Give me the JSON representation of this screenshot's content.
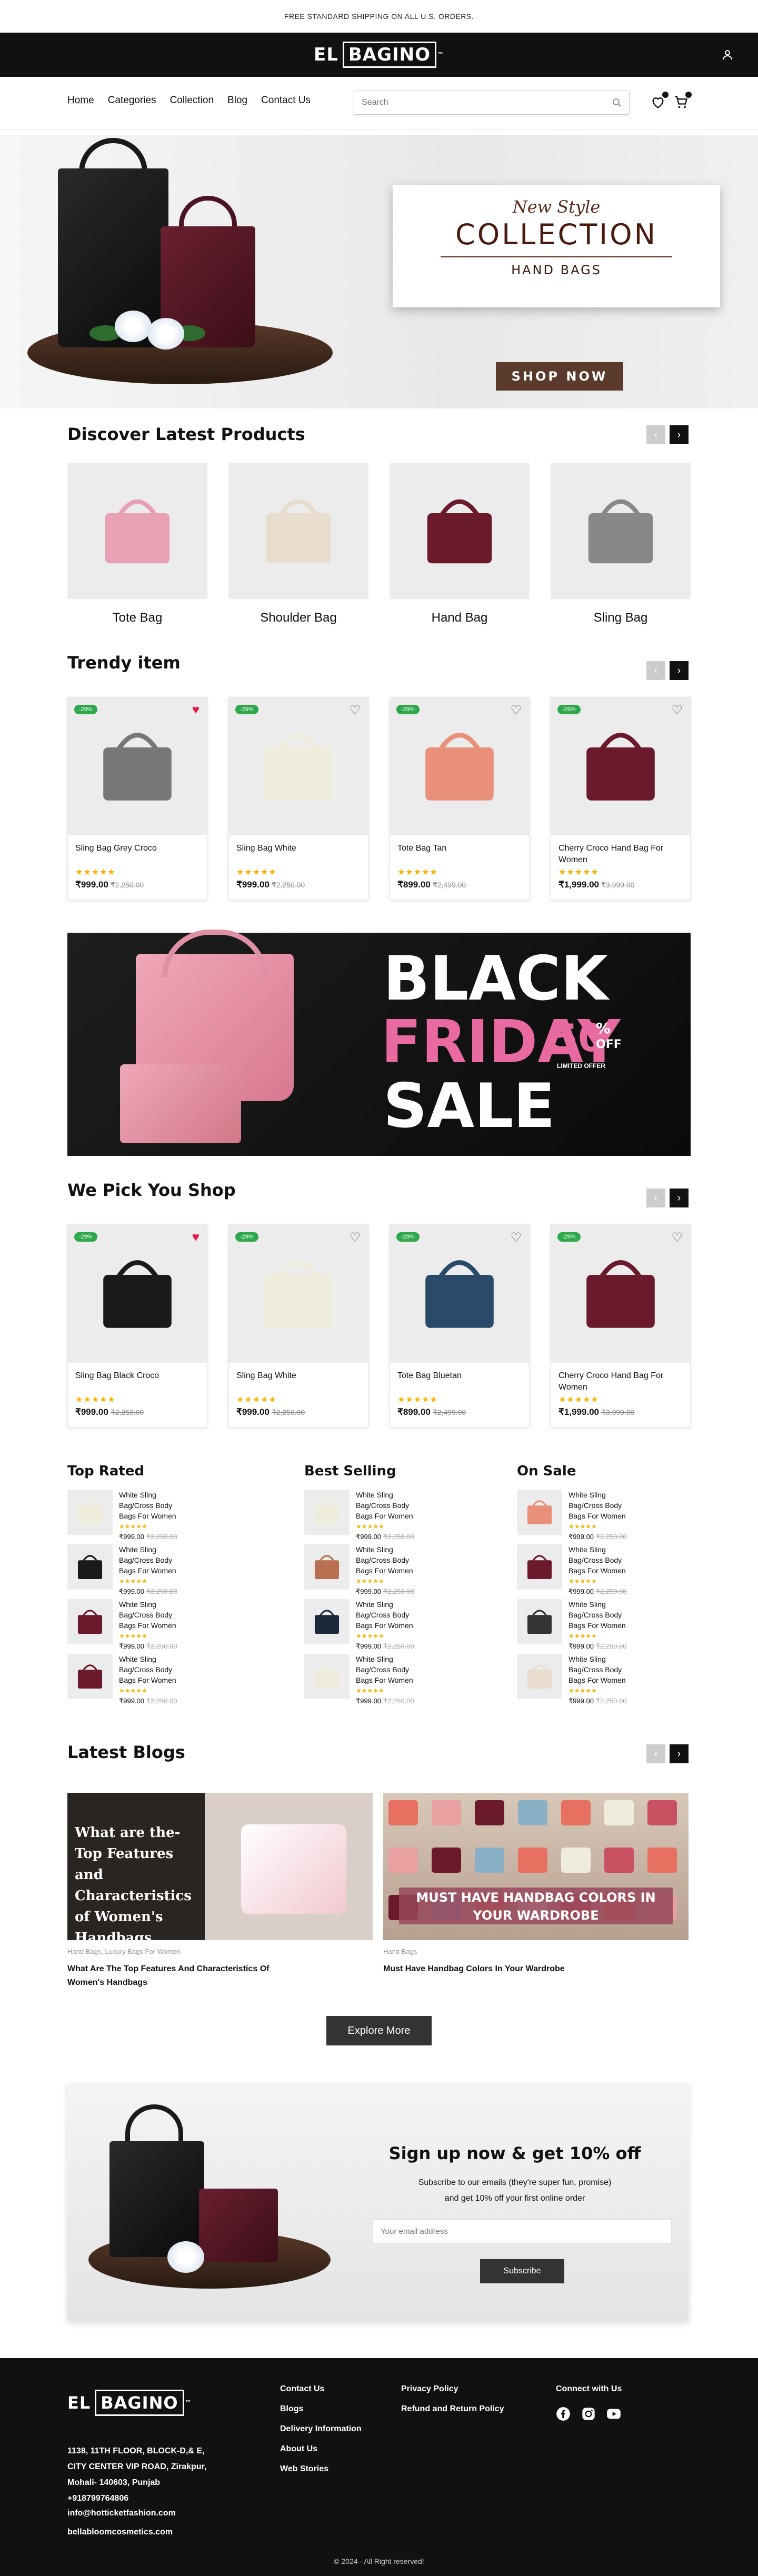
{
  "announcement": "FREE STANDARD SHIPPING ON ALL U.S. ORDERS.",
  "brand": {
    "el": "EL",
    "name": "BAGINO",
    "tm": "™"
  },
  "nav": [
    {
      "label": "Home"
    },
    {
      "label": "Categories"
    },
    {
      "label": "Collection"
    },
    {
      "label": "Blog"
    },
    {
      "label": "Contact Us"
    }
  ],
  "search": {
    "placeholder": "Search"
  },
  "header_icons": {
    "user": "user-icon",
    "wishlist": "heart-icon",
    "cart": "cart-icon"
  },
  "hero": {
    "new_style": "New Style",
    "collection": "COLLECTION",
    "hand_bags": "HAND BAGS",
    "cta": "SHOP NOW"
  },
  "discover": {
    "title": "Discover Latest Products",
    "categories": [
      {
        "label": "Tote Bag"
      },
      {
        "label": "Shoulder Bag"
      },
      {
        "label": "Hand Bag"
      },
      {
        "label": "Sling Bag"
      }
    ]
  },
  "trendy": {
    "title": "Trendy item",
    "products": [
      {
        "discount": "-29%",
        "name": "Sling Bag Grey Croco",
        "stars": "★★★★★",
        "price": "₹999.00",
        "old": "₹2,250.00",
        "fav": true
      },
      {
        "discount": "-29%",
        "name": "Sling Bag White",
        "stars": "★★★★★",
        "price": "₹999.00",
        "old": "₹2,250.00",
        "fav": false
      },
      {
        "discount": "-29%",
        "name": "Tote Bag Tan",
        "stars": "★★★★★",
        "price": "₹899.00",
        "old": "₹2,499.00",
        "fav": false
      },
      {
        "discount": "-29%",
        "name": "Cherry Croco Hand Bag For Women",
        "stars": "★★★★★",
        "price": "₹1,999.00",
        "old": "₹3,999.00",
        "fav": false
      }
    ]
  },
  "black_friday": {
    "l1": "BLACK",
    "l2": "FRIDAY",
    "l3": "SALE",
    "pct": "50",
    "pct_sign": "%",
    "off": "OFF",
    "limited": "LIMITED OFFER"
  },
  "pick": {
    "title": "We Pick You Shop",
    "products": [
      {
        "discount": "-29%",
        "name": "Sling Bag Black Croco",
        "stars": "★★★★★",
        "price": "₹999.00",
        "old": "₹2,250.00",
        "fav": true
      },
      {
        "discount": "-29%",
        "name": "Sling Bag White",
        "stars": "★★★★★",
        "price": "₹999.00",
        "old": "₹2,250.00",
        "fav": false
      },
      {
        "discount": "-29%",
        "name": "Tote Bag Bluetan",
        "stars": "★★★★★",
        "price": "₹899.00",
        "old": "₹2,499.00",
        "fav": false
      },
      {
        "discount": "-29%",
        "name": "Cherry Croco Hand Bag For Women",
        "stars": "★★★★★",
        "price": "₹1,999.00",
        "old": "₹3,999.00",
        "fav": false
      }
    ]
  },
  "lists": [
    {
      "title": "Top Rated",
      "items": [
        {
          "name": "White Sling Bag/Cross Body Bags For Women",
          "stars": "★★★★★",
          "price": "₹999.00",
          "old": "₹2,250.00"
        },
        {
          "name": "White Sling Bag/Cross Body Bags For Women",
          "stars": "★★★★★",
          "price": "₹999.00",
          "old": "₹2,250.00"
        },
        {
          "name": "White Sling Bag/Cross Body Bags For Women",
          "stars": "★★★★★",
          "price": "₹999.00",
          "old": "₹2,250.00"
        },
        {
          "name": "White Sling Bag/Cross Body Bags For Women",
          "stars": "★★★★★",
          "price": "₹999.00",
          "old": "₹2,250.00"
        }
      ]
    },
    {
      "title": "Best Selling",
      "items": [
        {
          "name": "White Sling Bag/Cross Body Bags For Women",
          "stars": "★★★★★",
          "price": "₹999.00",
          "old": "₹2,250.00"
        },
        {
          "name": "White Sling Bag/Cross Body Bags For Women",
          "stars": "★★★★★",
          "price": "₹999.00",
          "old": "₹2,250.00"
        },
        {
          "name": "White Sling Bag/Cross Body Bags For Women",
          "stars": "★★★★★",
          "price": "₹999.00",
          "old": "₹2,250.00"
        },
        {
          "name": "White Sling Bag/Cross Body Bags For Women",
          "stars": "★★★★★",
          "price": "₹999.00",
          "old": "₹2,250.00"
        }
      ]
    },
    {
      "title": "On Sale",
      "items": [
        {
          "name": "White Sling Bag/Cross Body Bags For Women",
          "stars": "★★★★★",
          "price": "₹999.00",
          "old": "₹2,250.00"
        },
        {
          "name": "White Sling Bag/Cross Body Bags For Women",
          "stars": "★★★★★",
          "price": "₹999.00",
          "old": "₹2,250.00"
        },
        {
          "name": "White Sling Bag/Cross Body Bags For Women",
          "stars": "★★★★★",
          "price": "₹999.00",
          "old": "₹2,250.00"
        },
        {
          "name": "White Sling Bag/Cross Body Bags For Women",
          "stars": "★★★★★",
          "price": "₹999.00",
          "old": "₹2,250.00"
        }
      ]
    }
  ],
  "blogs": {
    "title": "Latest Blogs",
    "posts": [
      {
        "overlay": "What are the- Top Features and Characteristics of Women's Handbags",
        "meta": "Hand Bags, Luxury Bags For Women",
        "title": "What Are The Top Features And Characteristics Of Women's Handbags"
      },
      {
        "overlay": "MUST HAVE HANDBAG COLORS IN YOUR WARDROBE",
        "meta": "Hand Bags",
        "title": "Must Have Handbag Colors In Your Wardrobe"
      }
    ],
    "explore": "Explore More"
  },
  "signup": {
    "title": "Sign up now & get 10% off",
    "line1": "Subscribe to our emails (they're super fun, promise)",
    "line2": "and get 10% off your first online order",
    "placeholder": "Your email address",
    "button": "Subscribe"
  },
  "footer": {
    "address": [
      "1138, 11TH FLOOR, BLOCK-D,& E,",
      "CITY CENTER VIP ROAD, Zirakpur,",
      "Mohali- 140603, Punjab"
    ],
    "phone": "+918799764806",
    "email1": "info@hotticketfashion.com",
    "email2": "bellabloomcosmetics.com",
    "col1": [
      "Contact Us",
      "Blogs",
      "Delivery Information",
      "About Us",
      "Web Stories"
    ],
    "col2": [
      "Privacy Policy",
      "Refund and Return Policy"
    ],
    "connect": "Connect with Us",
    "copyright": "© 2024 - All Right reserved!"
  },
  "colors": {
    "accent": "#5a3a2a",
    "discount": "#2ea84a",
    "star": "#f5b400",
    "heart": "#e8174a",
    "pink": "#e86aa0"
  }
}
